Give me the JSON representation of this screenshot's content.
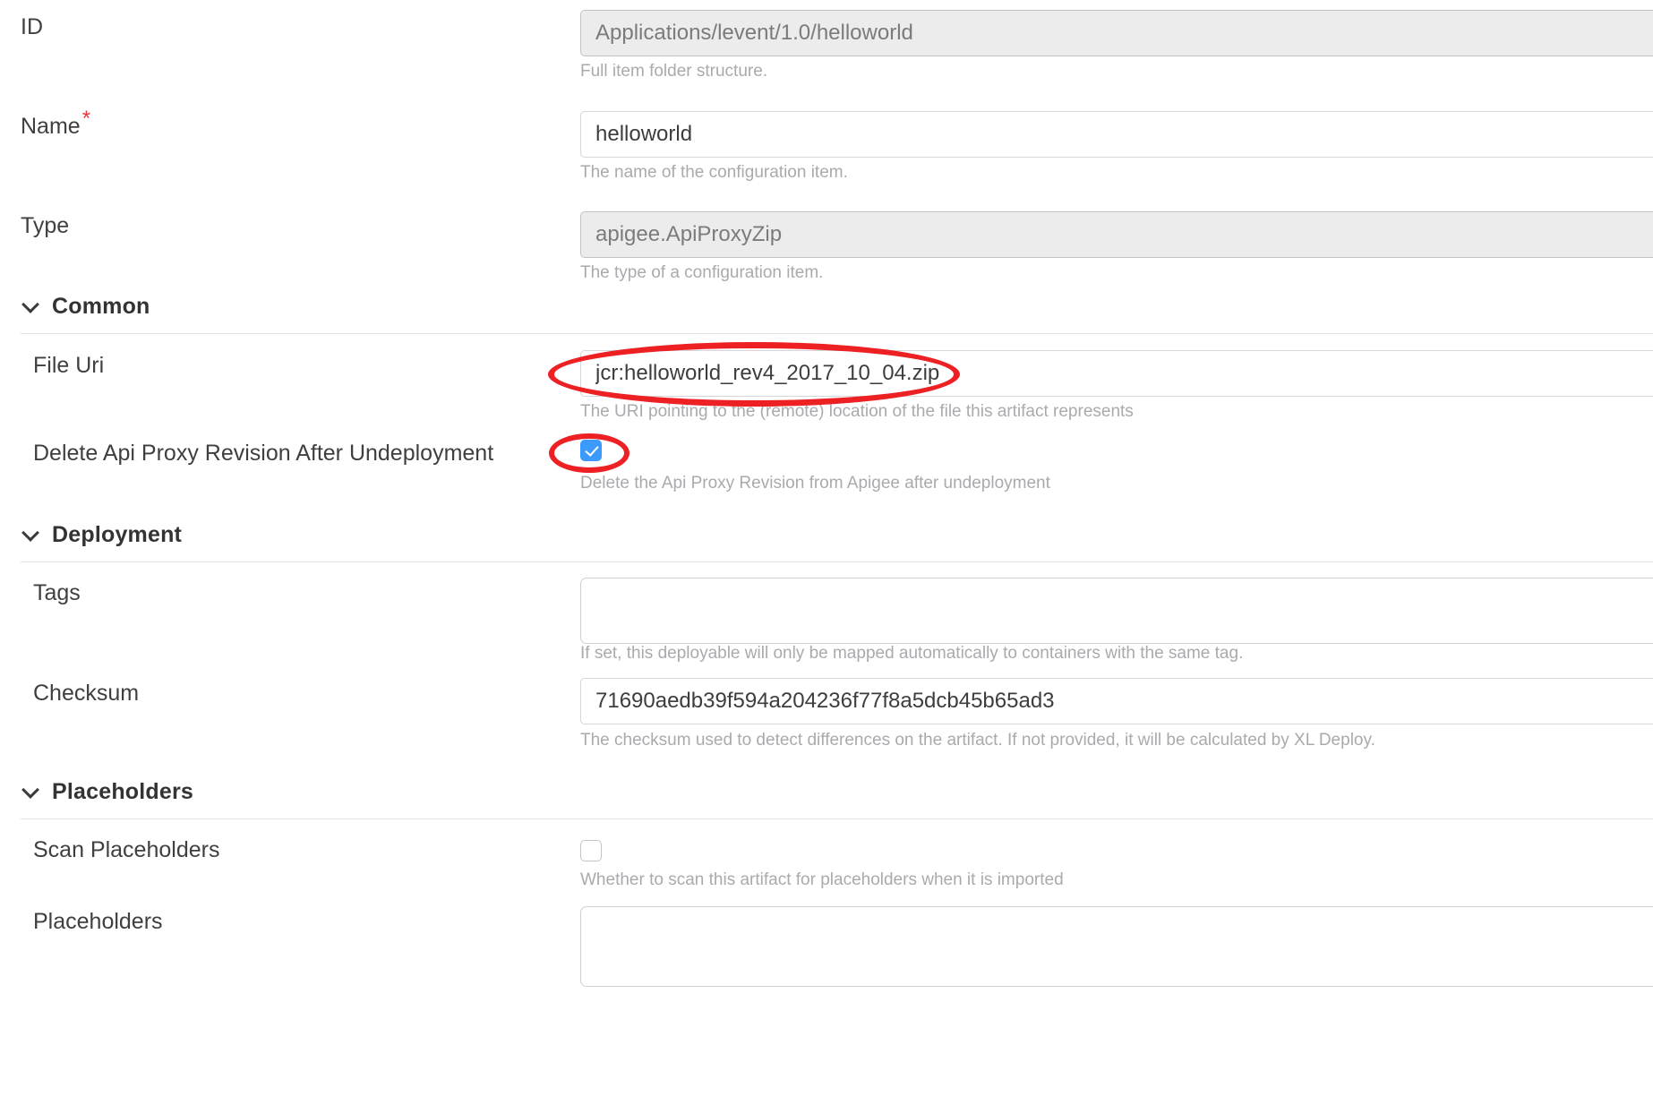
{
  "form": {
    "fields": [
      {
        "label": "ID",
        "required": false,
        "value": "Applications/levent/1.0/helloworld",
        "placeholder": "",
        "help": "Full item folder structure.",
        "disabled": true,
        "control": "text"
      },
      {
        "label": "Name",
        "required": true,
        "value": "helloworld",
        "placeholder": "",
        "help": "The name of the configuration item.",
        "disabled": false,
        "control": "text"
      },
      {
        "label": "Type",
        "required": false,
        "value": "apigee.ApiProxyZip",
        "placeholder": "",
        "help": "The type of a configuration item.",
        "disabled": true,
        "control": "text"
      }
    ]
  },
  "sections": [
    {
      "title": "Common",
      "expanded": true,
      "chevron_icon": "chevron-down-icon",
      "fields": [
        {
          "label": "File Uri",
          "value": "jcr:helloworld_rev4_2017_10_04.zip",
          "placeholder": "",
          "help": "The URI pointing to the (remote) location of the file this artifact represents",
          "control": "text",
          "annotated": true
        },
        {
          "label": "Delete Api Proxy Revision After Undeployment",
          "checked": true,
          "help": "Delete the Api Proxy Revision from Apigee after undeployment",
          "control": "checkbox",
          "annotated": true
        }
      ]
    },
    {
      "title": "Deployment",
      "expanded": true,
      "chevron_icon": "chevron-down-icon",
      "fields": [
        {
          "label": "Tags",
          "value": "",
          "placeholder": "",
          "help": "If set, this deployable will only be mapped automatically to containers with the same tag.",
          "control": "textarea",
          "annotated": false
        },
        {
          "label": "Checksum",
          "value": "71690aedb39f594a204236f77f8a5dcb45b65ad3",
          "placeholder": "",
          "help": "The checksum used to detect differences on the artifact. If not provided, it will be calculated by XL Deploy.",
          "control": "text",
          "annotated": false
        }
      ]
    },
    {
      "title": "Placeholders",
      "expanded": true,
      "chevron_icon": "chevron-down-icon",
      "fields": [
        {
          "label": "Scan Placeholders",
          "checked": false,
          "help": "Whether to scan this artifact for placeholders when it is imported",
          "control": "checkbox",
          "annotated": false
        },
        {
          "label": "Placeholders",
          "value": "",
          "placeholder": "",
          "help": "",
          "control": "textarea",
          "annotated": false
        }
      ]
    }
  ],
  "colors": {
    "annotation": "#ed2024",
    "checkbox_checked": "#3b9afc",
    "required_marker": "#e8363d",
    "help_text": "#a9aaad",
    "label_text": "#3f3f3f",
    "disabled_field_bg": "#ececec"
  }
}
